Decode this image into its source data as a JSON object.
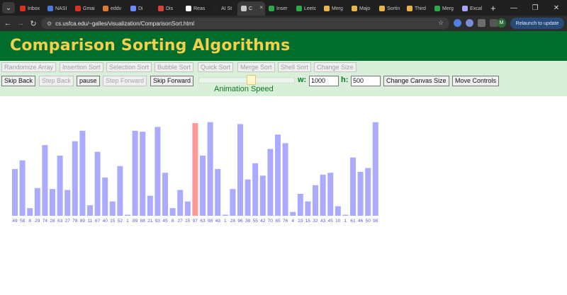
{
  "browser": {
    "tabs": [
      {
        "label": "Inbox",
        "fav": "#d93025"
      },
      {
        "label": "NASI",
        "fav": "#4a78d8"
      },
      {
        "label": "Gmai",
        "fav": "#d93025"
      },
      {
        "label": "eddv",
        "fav": "#e07a2c"
      },
      {
        "label": "Di",
        "fav": "#6b8cff"
      },
      {
        "label": "Dis",
        "fav": "#d9413a"
      },
      {
        "label": "Reas",
        "fav": "#ffffff"
      },
      {
        "label": "AI St",
        "fav": "#222222"
      },
      {
        "label": "C",
        "fav": "#c9c9c9",
        "active": true
      },
      {
        "label": "Inser",
        "fav": "#2aa84a"
      },
      {
        "label": "Leetc",
        "fav": "#2aa84a"
      },
      {
        "label": "Merg",
        "fav": "#e8b44a"
      },
      {
        "label": "Majo",
        "fav": "#e8b44a"
      },
      {
        "label": "Sortin",
        "fav": "#e8b44a"
      },
      {
        "label": "Third",
        "fav": "#e8b44a"
      },
      {
        "label": "Merg",
        "fav": "#2aa84a"
      },
      {
        "label": "Excal",
        "fav": "#a9a3ff"
      }
    ],
    "tab_close": "×",
    "new_tab": "+",
    "window_controls": {
      "minimize": "—",
      "maximize": "❐",
      "close": "✕"
    },
    "url": "cs.usfca.edu/~galles/visualization/ComparisonSort.html",
    "relaunch_label": "Relaunch to update",
    "profile_initial": "M"
  },
  "page": {
    "title": "Comparison Sorting Algorithms"
  },
  "algorithm_buttons": [
    "Randomize Array",
    "Insertion Sort",
    "Selection Sort",
    "Bubble Sort",
    "Quick Sort",
    "Merge Sort",
    "Shell Sort",
    "Change Size"
  ],
  "controls": {
    "skip_back": "Skip Back",
    "step_back": "Step Back",
    "pause": "pause",
    "step_forward": "Step Forward",
    "skip_forward": "Skip Forward",
    "animation_speed": "Animation Speed",
    "width_label": "w:",
    "width_value": "1000",
    "height_label": "h:",
    "height_value": "500",
    "change_canvas_size": "Change Canvas Size",
    "move_controls": "Move Controls"
  },
  "colors": {
    "bar": "#aaaaff",
    "highlight_bar": "#ff9999",
    "label": "#5b5bd6"
  },
  "chart_data": {
    "type": "bar",
    "values": [
      49,
      58,
      8,
      29,
      74,
      28,
      63,
      27,
      78,
      89,
      11,
      67,
      40,
      15,
      52,
      1,
      89,
      88,
      21,
      93,
      45,
      8,
      27,
      15,
      97,
      63,
      98,
      49,
      1,
      28,
      96,
      38,
      55,
      42,
      70,
      85,
      76,
      4,
      23,
      15,
      32,
      43,
      45,
      10,
      1,
      61,
      46,
      50,
      98
    ],
    "highlighted_indices": [
      24
    ]
  }
}
